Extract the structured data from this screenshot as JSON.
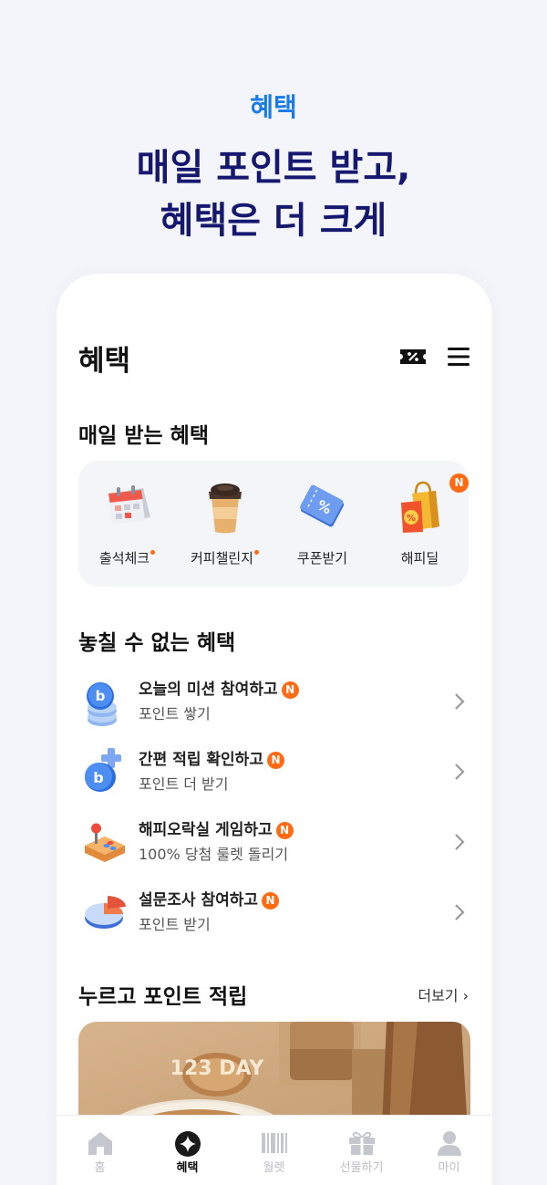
{
  "promo": {
    "tag": "혜택",
    "headline_line1": "매일 포인트 받고,",
    "headline_line2": "혜택은 더 크게"
  },
  "header": {
    "title": "혜택",
    "icons": [
      "coupon-icon",
      "menu-icon"
    ]
  },
  "daily": {
    "title": "매일 받는 혜택",
    "items": [
      {
        "label": "출석체크",
        "icon": "calendar-icon",
        "dot": true
      },
      {
        "label": "커피챌린지",
        "icon": "coffee-cup-icon",
        "dot": true
      },
      {
        "label": "쿠폰받기",
        "icon": "coupon-ticket-icon",
        "dot": false
      },
      {
        "label": "해피딜",
        "icon": "shopping-bag-icon",
        "badge": "N"
      }
    ]
  },
  "missions": {
    "title": "놓칠 수 없는 혜택",
    "items": [
      {
        "title": "오늘의 미션 참여하고",
        "badge": "N",
        "subtitle": "포인트 쌓기",
        "icon": "point-coins-icon"
      },
      {
        "title": "간편 적립 확인하고",
        "badge": "N",
        "subtitle": "포인트 더 받기",
        "icon": "point-plus-icon"
      },
      {
        "title": "해피오락실 게임하고",
        "badge": "N",
        "subtitle": "100% 당첨 룰렛 돌리기",
        "icon": "arcade-joystick-icon"
      },
      {
        "title": "설문조사 참여하고",
        "badge": "N",
        "subtitle": "포인트 받기",
        "icon": "pie-chart-icon"
      }
    ]
  },
  "tap_points": {
    "title": "누르고 포인트 적립",
    "more_label": "더보기 ›",
    "banner_text": "123 DAY"
  },
  "tabbar": {
    "tabs": [
      {
        "label": "홈",
        "icon": "home-icon"
      },
      {
        "label": "혜택",
        "icon": "sparkle-icon",
        "active": true
      },
      {
        "label": "월렛",
        "icon": "barcode-icon"
      },
      {
        "label": "선물하기",
        "icon": "gift-icon"
      },
      {
        "label": "마이",
        "icon": "person-icon"
      }
    ]
  },
  "colors": {
    "accent_blue": "#1b7be6",
    "headline_navy": "#15186e",
    "badge_orange": "#ff6a13"
  }
}
